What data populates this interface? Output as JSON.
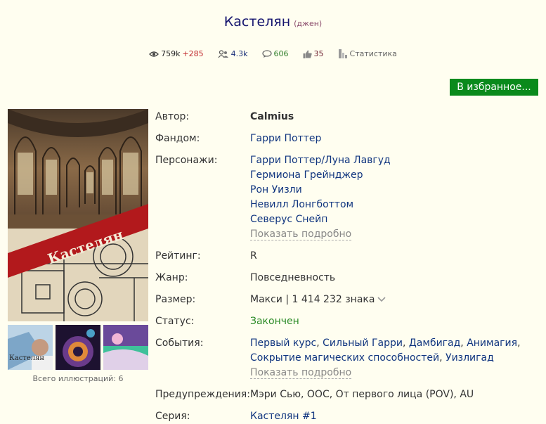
{
  "header": {
    "title": "Кастелян",
    "genre": "(джен)"
  },
  "stats": {
    "views": "759k",
    "views_delta": "+285",
    "readers": "4.3k",
    "comments": "606",
    "likes": "35",
    "statistics_label": "Статистика"
  },
  "fav_button": "В избранное...",
  "cover": {
    "title_text": "Кастелян"
  },
  "thumbs": {
    "first_caption": "Кастелян"
  },
  "illustrations": "Всего иллюстраций: 6",
  "info": {
    "author_label": "Автор:",
    "author": "Calmius",
    "fandom_label": "Фандом:",
    "fandom": "Гарри Поттер",
    "characters_label": "Персонажи:",
    "characters": [
      "Гарри Поттер/Луна Лавгуд",
      "Гермиона Грейнджер",
      "Рон Уизли",
      "Невилл Лонгботтом",
      "Северус Снейп"
    ],
    "show_more": "Показать подробно",
    "rating_label": "Рейтинг:",
    "rating": "R",
    "genre_label": "Жанр:",
    "genre": "Повседневность",
    "size_label": "Размер:",
    "size": "Макси | 1 414 232 знака",
    "status_label": "Статус:",
    "status": "Закончен",
    "events_label": "События:",
    "events": [
      "Первый курс",
      "Сильный Гарри",
      "Дамбигад",
      "Анимагия",
      "Сокрытие магических способностей",
      "Уизлигад"
    ],
    "warnings_label": "Предупреждения:",
    "warnings": "Мэри Сью, ООС, От первого лица (POV), AU",
    "series_label": "Серия:",
    "series": "Кастелян #1"
  },
  "colors": {
    "accent_green": "#0a8a1c",
    "link_blue": "#10357f",
    "background": "#fffef0"
  }
}
